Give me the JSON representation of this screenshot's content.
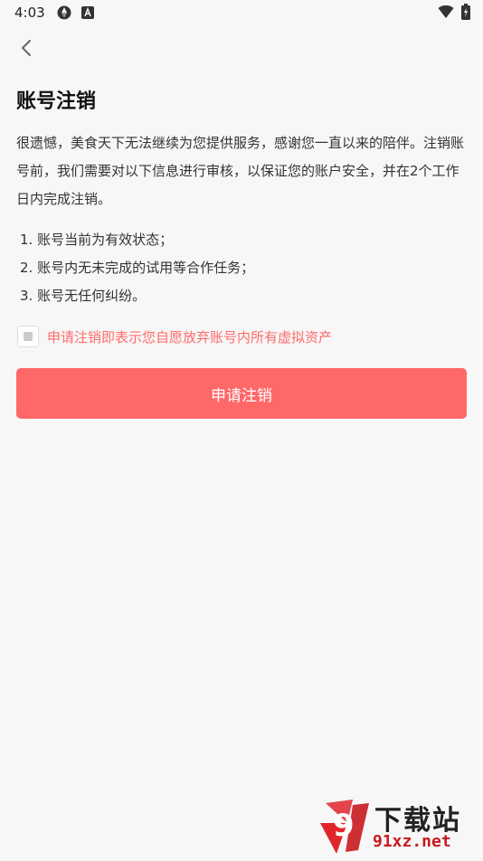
{
  "status_bar": {
    "time": "4:03",
    "icons": [
      "sync-icon",
      "font-a-icon",
      "wifi-icon",
      "battery-icon"
    ]
  },
  "header": {
    "back_icon": "chevron-left-icon"
  },
  "page": {
    "title": "账号注销",
    "intro": "很遗憾，美食天下无法继续为您提供服务，感谢您一直以来的陪伴。注销账号前，我们需要对以下信息进行审核，以保证您的账户安全，并在2个工作日内完成注销。",
    "conditions": [
      "1. 账号当前为有效状态；",
      "2. 账号内无未完成的试用等合作任务；",
      "3. 账号无任何纠纷。"
    ],
    "agree_text": "申请注销即表示您自愿放弃账号内所有虚拟资产",
    "submit_label": "申请注销"
  },
  "watermark": {
    "logo_text": "9",
    "title": "下载站",
    "url": "91xz.net"
  },
  "colors": {
    "accent": "#ff6868",
    "agree_text": "#ff6b6b",
    "background": "#f7f7f7"
  }
}
